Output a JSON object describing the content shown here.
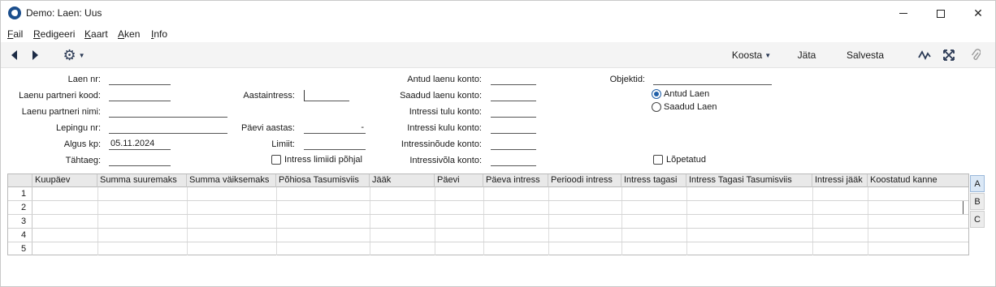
{
  "window": {
    "title": "Demo: Laen: Uus"
  },
  "menu": [
    {
      "accel": "F",
      "rest": "ail"
    },
    {
      "accel": "R",
      "rest": "edigeeri"
    },
    {
      "accel": "K",
      "rest": "aart"
    },
    {
      "accel": "A",
      "rest": "ken"
    },
    {
      "accel": "I",
      "rest": "nfo"
    }
  ],
  "toolbar": {
    "koosta": "Koosta",
    "jata": "Jäta",
    "salvesta": "Salvesta"
  },
  "form": {
    "laen_nr": {
      "label": "Laen nr:",
      "value": ""
    },
    "partneri_kood": {
      "label": "Laenu partneri kood:",
      "value": ""
    },
    "partneri_nimi": {
      "label": "Laenu partneri nimi:",
      "value": ""
    },
    "lepingu_nr": {
      "label": "Lepingu nr:",
      "value": ""
    },
    "algus_kp": {
      "label": "Algus kp:",
      "value": "05.11.2024"
    },
    "tahtaeg": {
      "label": "Tähtaeg:",
      "value": ""
    },
    "aastaintress": {
      "label": "Aastaintress:",
      "value": ""
    },
    "paevi_aastas": {
      "label": "Päevi aastas:",
      "value": "-"
    },
    "limiit": {
      "label": "Limiit:",
      "value": ""
    },
    "intress_limiidi": {
      "label": "Intress limiidi põhjal"
    },
    "antud_konto": {
      "label": "Antud laenu konto:",
      "value": ""
    },
    "saadud_konto": {
      "label": "Saadud laenu konto:",
      "value": ""
    },
    "tulu_konto": {
      "label": "Intressi tulu konto:",
      "value": ""
    },
    "kulu_konto": {
      "label": "Intressi kulu konto:",
      "value": ""
    },
    "noude_konto": {
      "label": "Intressinõude konto:",
      "value": ""
    },
    "vola_konto": {
      "label": "Intressivõla konto:",
      "value": ""
    },
    "objektid": {
      "label": "Objektid:",
      "value": ""
    },
    "radio_antud": {
      "label": "Antud Laen",
      "selected": true
    },
    "radio_saadud": {
      "label": "Saadud Laen",
      "selected": false
    },
    "lopetatud": {
      "label": "Lõpetatud"
    }
  },
  "grid": {
    "columns": [
      "Kuupäev",
      "Summa suuremaks",
      "Summa väiksemaks",
      "Põhiosa Tasumisviis",
      "Jääk",
      "Päevi",
      "Päeva intress",
      "Perioodi intress",
      "Intress tagasi",
      "Intress Tagasi Tasumisviis",
      "Intressi jääk",
      "Koostatud kanne"
    ],
    "rows": [
      "1",
      "2",
      "3",
      "4",
      "5"
    ]
  },
  "side_tabs": [
    "A",
    "B",
    "C"
  ]
}
